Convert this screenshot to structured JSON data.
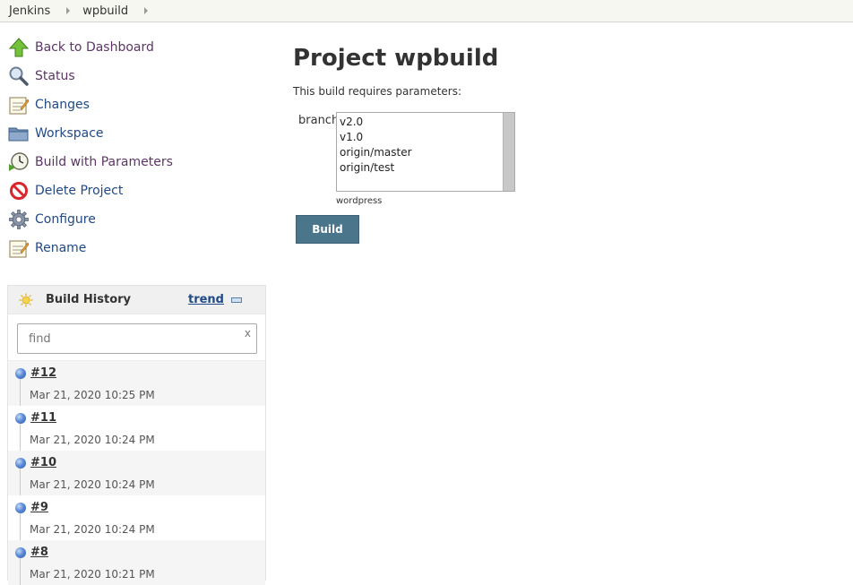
{
  "breadcrumb": {
    "items": [
      "Jenkins",
      "wpbuild"
    ]
  },
  "tasks": [
    {
      "label": "Back to Dashboard",
      "icon": "up-arrow-icon",
      "visited": true
    },
    {
      "label": "Status",
      "icon": "magnifier-icon",
      "visited": true
    },
    {
      "label": "Changes",
      "icon": "notepad-icon",
      "visited": false
    },
    {
      "label": "Workspace",
      "icon": "folder-icon",
      "visited": false
    },
    {
      "label": "Build with Parameters",
      "icon": "clock-icon",
      "visited": true
    },
    {
      "label": "Delete Project",
      "icon": "no-entry-icon",
      "visited": false
    },
    {
      "label": "Configure",
      "icon": "gear-icon",
      "visited": false
    },
    {
      "label": "Rename",
      "icon": "notepad-icon",
      "visited": false
    }
  ],
  "history": {
    "title": "Build History",
    "trend": "trend",
    "find_placeholder": "find",
    "clear": "x",
    "builds": [
      {
        "number": "#12",
        "date": "Mar 21, 2020 10:25 PM"
      },
      {
        "number": "#11",
        "date": "Mar 21, 2020 10:24 PM"
      },
      {
        "number": "#10",
        "date": "Mar 21, 2020 10:24 PM"
      },
      {
        "number": "#9",
        "date": "Mar 21, 2020 10:24 PM"
      },
      {
        "number": "#8",
        "date": "Mar 21, 2020 10:21 PM"
      }
    ]
  },
  "main": {
    "title": "Project wpbuild",
    "requires": "This build requires parameters:",
    "param": {
      "name": "branch",
      "options": [
        "v2.0",
        "v1.0",
        "origin/master",
        "origin/test"
      ],
      "description": "wordpress"
    },
    "build_button": "Build"
  }
}
